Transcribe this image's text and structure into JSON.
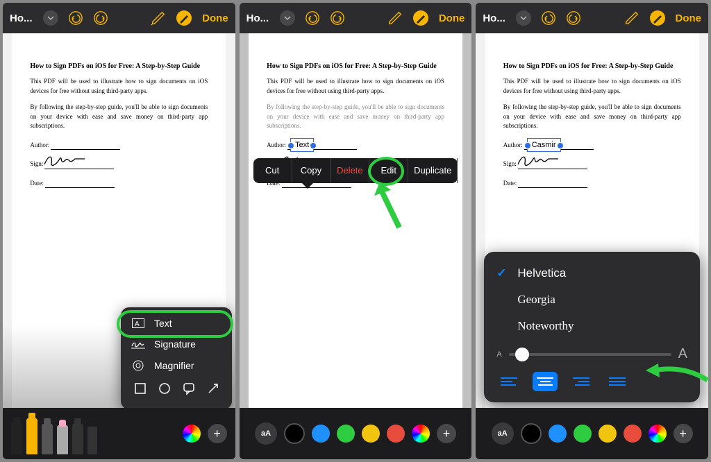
{
  "topbar": {
    "title": "Ho...",
    "done": "Done"
  },
  "document": {
    "heading": "How to Sign PDFs on iOS for Free: A Step-by-Step Guide",
    "p1": "This PDF will be used to illustrate how to sign documents on iOS devices for free without using third-party apps.",
    "p2": "By following the step-by-step guide, you'll be able to sign documents on your device with ease and save money on third-party app subscriptions.",
    "author_label": "Author:",
    "sign_label": "Sign:",
    "date_label": "Date:"
  },
  "plus_menu": {
    "text": "Text",
    "signature": "Signature",
    "magnifier": "Magnifier"
  },
  "context_menu": {
    "cut": "Cut",
    "copy": "Copy",
    "delete": "Delete",
    "edit": "Edit",
    "duplicate": "Duplicate"
  },
  "textbox": {
    "placeholder": "Text",
    "filled": "Casmir"
  },
  "font_panel": {
    "fonts": [
      "Helvetica",
      "Georgia",
      "Noteworthy"
    ],
    "selected": "Helvetica",
    "small_a": "A",
    "big_a": "A"
  },
  "aa_label": "aA",
  "colors": {
    "black": "#000000",
    "blue": "#1e90ff",
    "green": "#2ecc40",
    "yellow": "#f1c40f",
    "red": "#e74c3c"
  }
}
